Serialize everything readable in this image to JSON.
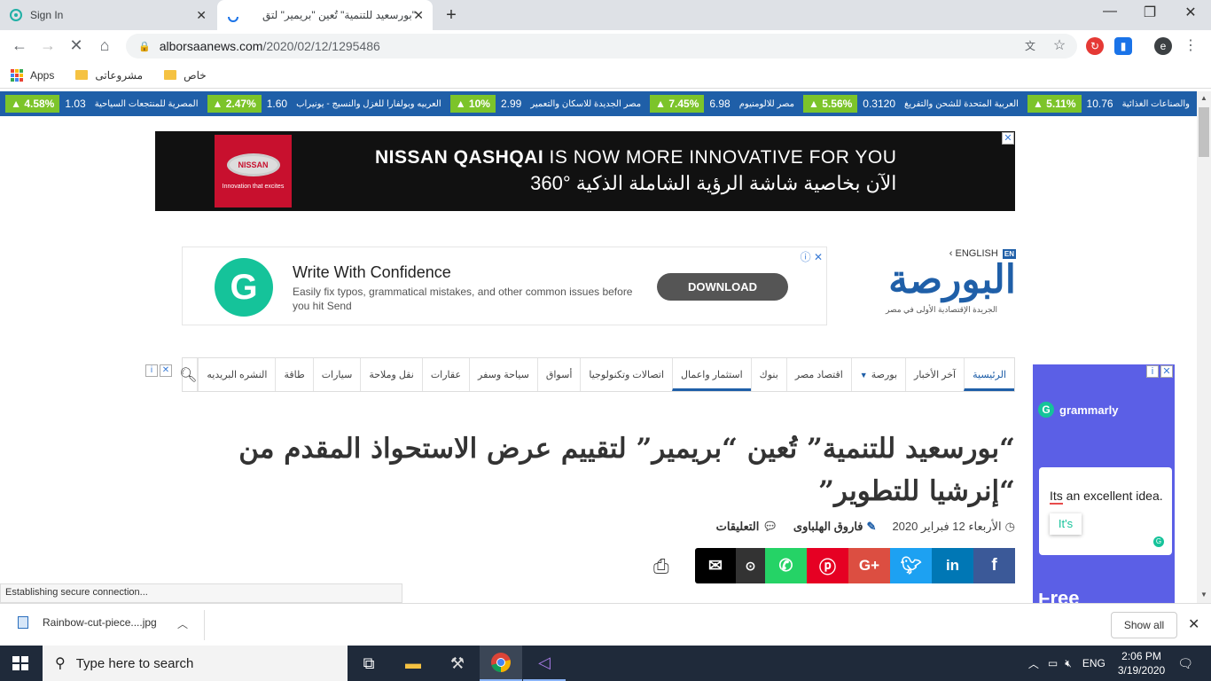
{
  "browser": {
    "tabs": [
      {
        "title": "Sign In"
      },
      {
        "title": "\"بورسعيد للتنمية\" تُعين \"بريمير\" لتق"
      }
    ],
    "new_tab": "+",
    "url_host": "alborsaanews.com",
    "url_path": "/2020/02/12/1295486",
    "profile_letter": "e",
    "bookmarks": [
      "Apps",
      "مشروعاتى",
      "خاص"
    ]
  },
  "ticker": [
    {
      "name": "والصناعات الغذائية",
      "value": "10.76",
      "change": "5.11%"
    },
    {
      "name": "العربية المتحدة للشحن والتفريغ",
      "value": "0.3120",
      "change": "5.56%"
    },
    {
      "name": "مصر للالومنيوم",
      "value": "6.98",
      "change": "7.45%"
    },
    {
      "name": "مصر الجديدة للاسكان والتعمير",
      "value": "2.99",
      "change": "10%"
    },
    {
      "name": "العربيه وبولفارا للغزل والنسيج - يونيراب",
      "value": "1.60",
      "change": "2.47%"
    },
    {
      "name": "المصرية للمنتجعات السياحية",
      "value": "1.03",
      "change": "4.58%"
    }
  ],
  "nissan_ad": {
    "logo": "NISSAN",
    "logo_tag": "Innovation that excites",
    "line1_bold": "NISSAN QASHQAI",
    "line1_rest": " IS NOW MORE INNOVATIVE FOR YOU",
    "line2": "الآن بخاصية شاشة الرؤية الشاملة الذكية °360"
  },
  "grammarly_ad": {
    "heading": "Write With Confidence",
    "body": "Easily fix typos, grammatical mistakes, and other common issues before you hit Send",
    "button": "DOWNLOAD"
  },
  "site": {
    "english_link": "ENGLISH",
    "name": "البورصة",
    "tagline": "الجريدة الإقتصادية الأولى في مصر"
  },
  "nav": [
    "الرئيسية",
    "آخر الأخبار",
    "بورصة",
    "اقتصاد مصر",
    "بنوك",
    "استثمار واعمال",
    "اتصالات وتكنولوجيا",
    "أسواق",
    "سياحة وسفر",
    "عقارات",
    "نقل وملاحة",
    "سيارات",
    "طاقة",
    "النشره البريديه"
  ],
  "article": {
    "headline": "“بورسعيد للتنمية” تُعين “بريمير” لتقييم عرض الاستحواذ المقدم من “إنرشيا للتطوير”",
    "date": "الأربعاء 12 فبراير 2020",
    "author": "فاروق الهلباوى",
    "comments": "التعليقات"
  },
  "right_ad": {
    "brand": "grammarly",
    "sample_text_err": "Its",
    "sample_text_rest": " an excellent idea.",
    "suggestion": "It's",
    "footer_text": "Free"
  },
  "status_text": "Establishing secure connection...",
  "download": {
    "filename": "Rainbow-cut-piece....jpg",
    "show_all": "Show all"
  },
  "taskbar": {
    "search_placeholder": "Type here to search",
    "lang": "ENG",
    "time": "2:06 PM",
    "date": "3/19/2020"
  },
  "colors": {
    "brand_blue": "#1f5fa8",
    "ticker_green": "#7cc42a",
    "grammarly_green": "#15c39a"
  }
}
